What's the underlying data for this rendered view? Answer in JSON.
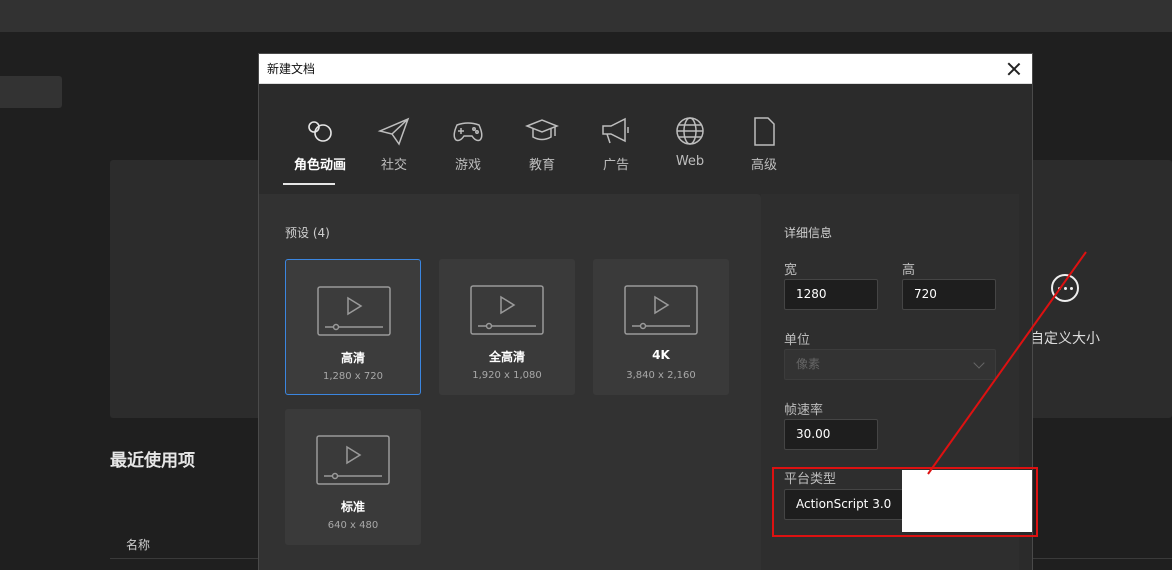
{
  "background": {
    "recent_title": "最近使用项",
    "col_name": "名称",
    "custom_label": "自定义大小"
  },
  "dialog": {
    "title": "新建文档",
    "tabs": [
      {
        "label": "角色动画",
        "icon": "character-animation-icon",
        "active": true
      },
      {
        "label": "社交",
        "icon": "paper-plane-icon"
      },
      {
        "label": "游戏",
        "icon": "gamepad-icon"
      },
      {
        "label": "教育",
        "icon": "graduation-cap-icon"
      },
      {
        "label": "广告",
        "icon": "megaphone-icon"
      },
      {
        "label": "Web",
        "icon": "globe-icon"
      },
      {
        "label": "高级",
        "icon": "document-icon"
      }
    ],
    "presets": {
      "heading": "预设 (4)",
      "items": [
        {
          "title": "高清",
          "size": "1,280 x 720",
          "selected": true
        },
        {
          "title": "全高清",
          "size": "1,920 x 1,080"
        },
        {
          "title": "4K",
          "size": "3,840 x 2,160"
        },
        {
          "title": "标准",
          "size": "640 x 480"
        }
      ]
    },
    "details": {
      "heading": "详细信息",
      "width_label": "宽",
      "width_value": "1280",
      "height_label": "高",
      "height_value": "720",
      "unit_label": "单位",
      "unit_value": "像素",
      "fps_label": "帧速率",
      "fps_value": "30.00",
      "platform_label": "平台类型",
      "platform_value": "ActionScript 3.0"
    }
  },
  "colors": {
    "accent_selected": "#3b86e0",
    "annotation": "#dd1111"
  }
}
